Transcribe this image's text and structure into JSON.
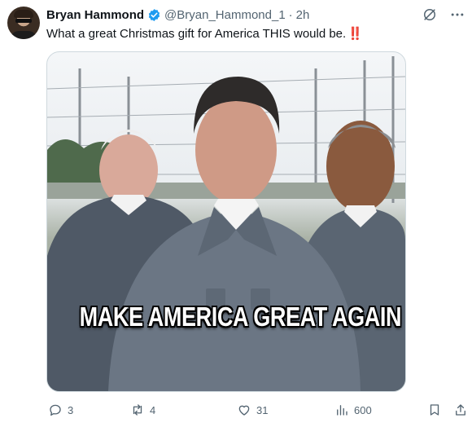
{
  "tweet": {
    "author_name": "Bryan Hammond",
    "handle": "@Bryan_Hammond_1",
    "separator": "·",
    "time": "2h",
    "text": "What a great Christmas gift for America THIS would be.",
    "emphasis": "‼️"
  },
  "media": {
    "caption": "MAKE AMERICA GREAT AGAIN"
  },
  "actions": {
    "replies": "3",
    "retweets": "4",
    "likes": "31",
    "views": "600"
  },
  "colors": {
    "verified": "#1d9bf0",
    "secondary_text": "#536471",
    "caption_text": "#ffffff"
  },
  "icons": [
    "grok-icon",
    "more-icon",
    "reply-icon",
    "retweet-icon",
    "like-icon",
    "views-icon",
    "bookmark-icon",
    "share-icon"
  ]
}
